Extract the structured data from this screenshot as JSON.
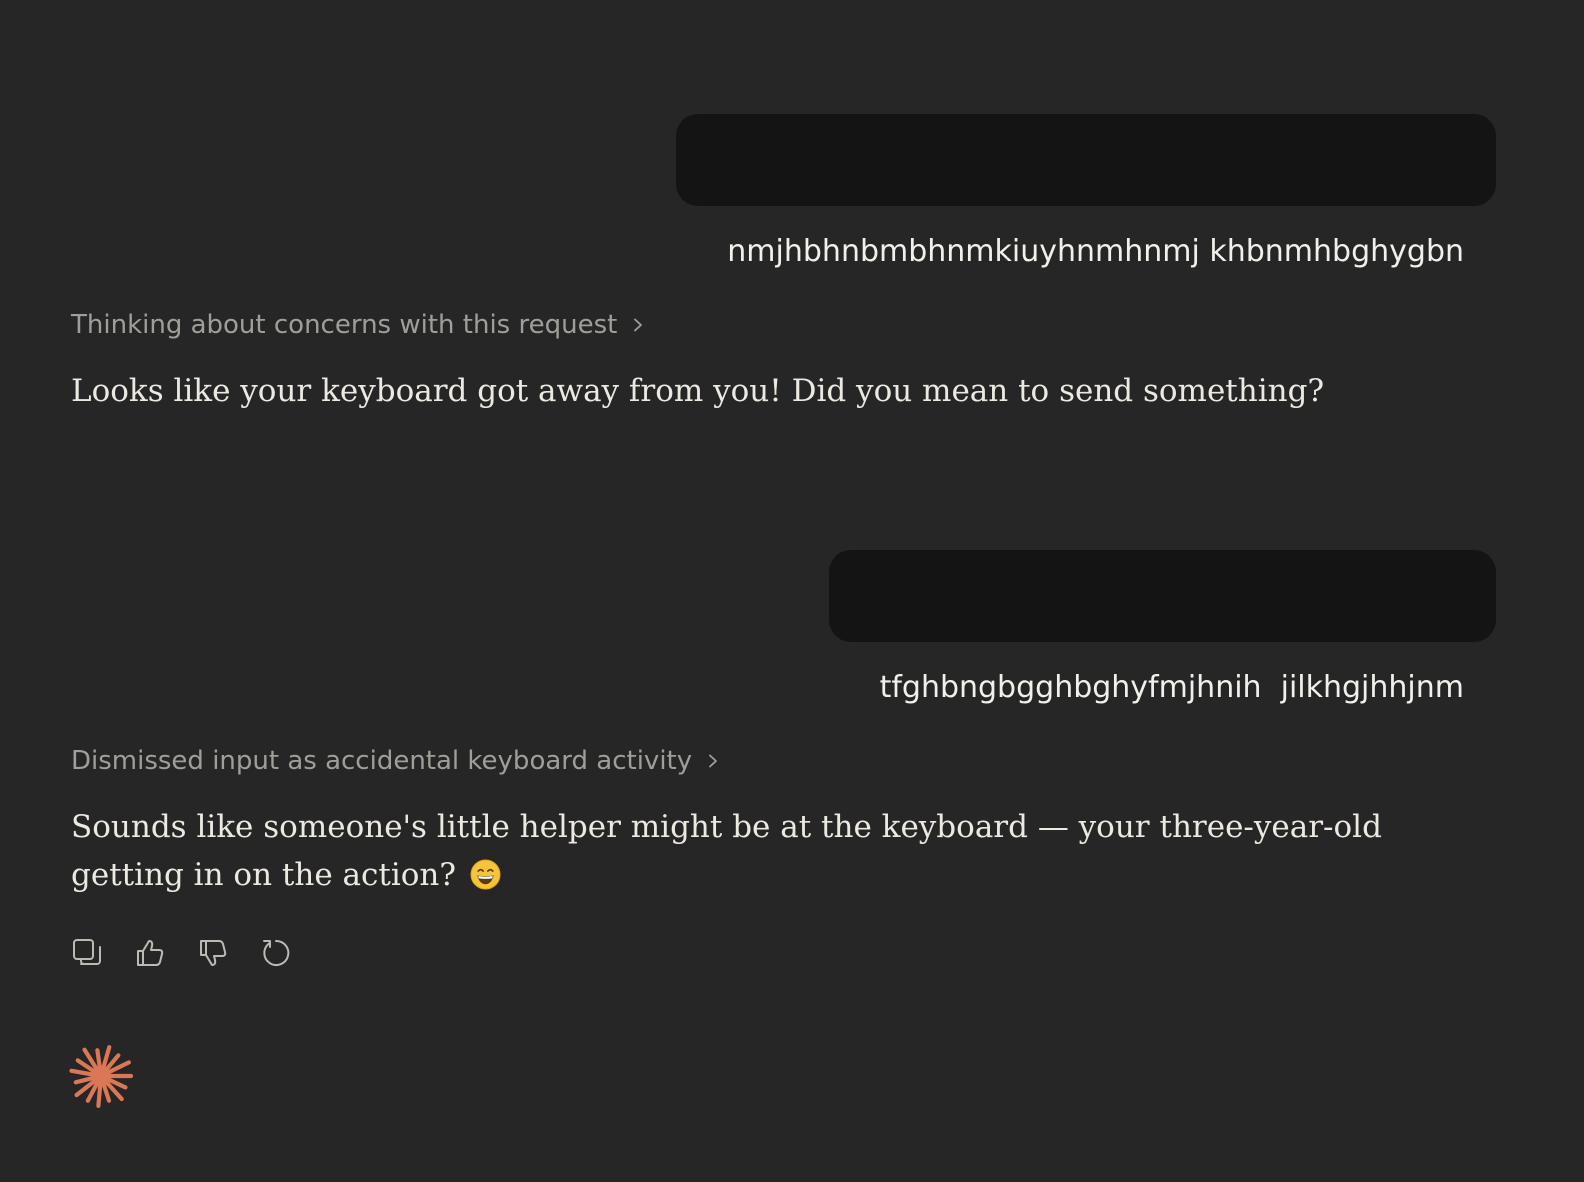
{
  "messages": [
    {
      "role": "user",
      "text": "nmjhbhnbmbhnmkiuyhnmhnmj khbnmhbghygbn"
    },
    {
      "role": "assistant",
      "thinking": "Thinking about concerns with this request",
      "text": "Looks like your keyboard got away from you! Did you mean to send something?"
    },
    {
      "role": "user",
      "text": "tfghbngbgghbghyfmjhnih  jilkhgjhhjnm"
    },
    {
      "role": "assistant",
      "thinking": "Dismissed input as accidental keyboard activity",
      "text": "Sounds like someone's little helper might be at the keyboard — your three-year-old getting in on the action?",
      "emoji": "grinning-face-emoji"
    }
  ],
  "actions": [
    {
      "icon": "copy-icon"
    },
    {
      "icon": "thumbs-up-icon"
    },
    {
      "icon": "thumbs-down-icon"
    },
    {
      "icon": "retry-icon"
    }
  ],
  "logo": {
    "icon": "assistant-spark-logo",
    "color": "#d97757"
  },
  "colors": {
    "background": "#262626",
    "user_bubble": "#141414",
    "text": "#ece9e1",
    "muted": "#a09e98"
  }
}
